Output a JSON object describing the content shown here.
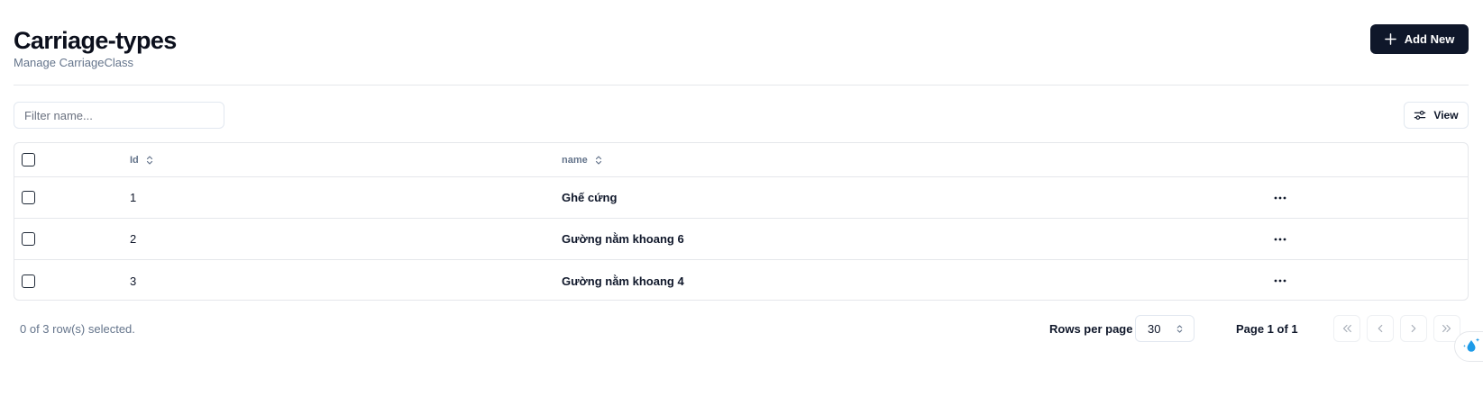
{
  "page": {
    "title": "Carriage-types",
    "subtitle": "Manage CarriageClass",
    "add_button_label": "Add New"
  },
  "toolbar": {
    "filter_placeholder": "Filter name...",
    "filter_value": "",
    "view_button_label": "View"
  },
  "table": {
    "columns": [
      {
        "label": "Id",
        "sortable": true
      },
      {
        "label": "name",
        "sortable": true
      }
    ],
    "rows": [
      {
        "id": "1",
        "name": "Ghế cứng"
      },
      {
        "id": "2",
        "name": "Gường nằm khoang 6"
      },
      {
        "id": "3",
        "name": "Gường nằm khoang 4"
      }
    ]
  },
  "footer": {
    "selection_text": "0 of 3 row(s) selected.",
    "rows_per_page_label": "Rows per page",
    "rows_per_page_value": "30",
    "page_info": "Page 1 of 1"
  },
  "icons": {
    "add": "plus-icon",
    "view": "sliders-icon",
    "sort": "chevrons-up-down-icon",
    "row_actions": "ellipsis-icon",
    "first_page": "chevrons-left-icon",
    "prev_page": "chevron-left-icon",
    "next_page": "chevron-right-icon",
    "last_page": "chevrons-right-icon",
    "widget": "droplet-sparkle-icon"
  },
  "colors": {
    "primary": "#0f172a",
    "muted_text": "#64748b",
    "border": "#e5e7eb",
    "widget_accent": "#1e9be8"
  }
}
